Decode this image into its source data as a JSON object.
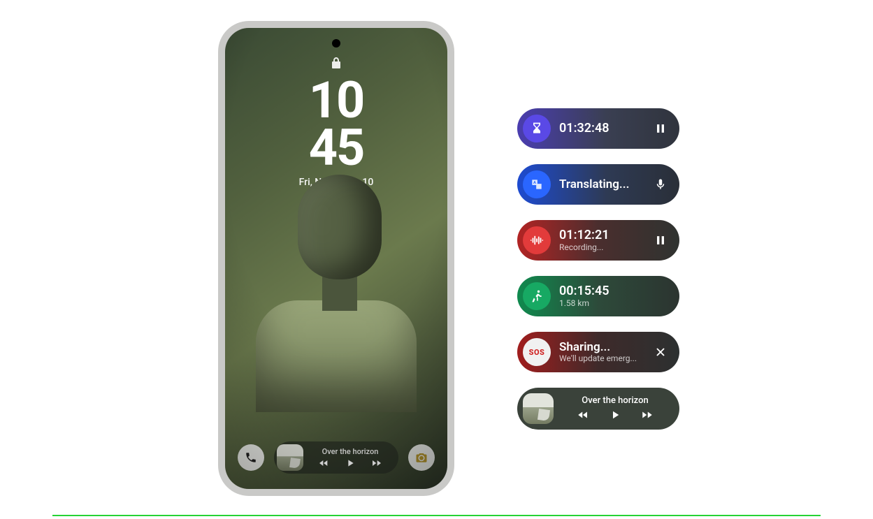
{
  "phone": {
    "clock_hours": "10",
    "clock_minutes": "45",
    "date": "Fri, November 10",
    "now_playing_title": "Over the horizon"
  },
  "pills": {
    "timer": {
      "time": "01:32:48"
    },
    "translate": {
      "label": "Translating..."
    },
    "record": {
      "time": "01:12:21",
      "status": "Recording..."
    },
    "run": {
      "time": "00:15:45",
      "distance": "1.58 km"
    },
    "sos": {
      "title": "Sharing...",
      "subtitle": "We'll update emerg..."
    },
    "music": {
      "title": "Over the horizon"
    }
  }
}
